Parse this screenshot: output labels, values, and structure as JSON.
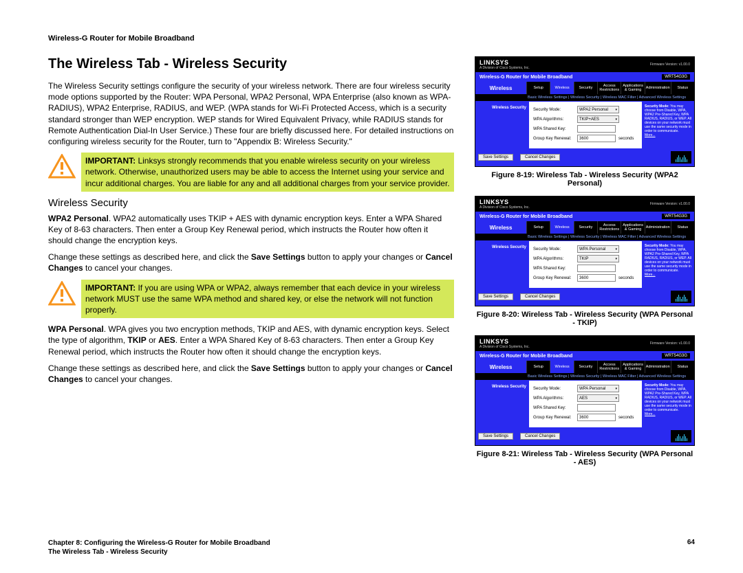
{
  "doc_header": "Wireless-G Router for Mobile Broadband",
  "section_title": "The Wireless Tab - Wireless Security",
  "intro": "The Wireless Security settings configure the security of your wireless network. There are four wireless security mode options supported by the Router: WPA Personal, WPA2 Personal, WPA Enterprise (also known as WPA-RADIUS), WPA2 Enterprise, RADIUS, and WEP. (WPA stands for Wi-Fi Protected Access, which is a security standard stronger than WEP encryption. WEP stands for Wired Equivalent Privacy, while RADIUS stands for Remote Authentication Dial-In User Service.) These four are briefly discussed here. For detailed instructions on configuring wireless security for the Router, turn to \"Appendix B: Wireless Security.\"",
  "callout1_bold": "IMPORTANT:",
  "callout1_text": " Linksys strongly recommends that you enable wireless security on your wireless network. Otherwise, unauthorized users may be able to access the Internet using your service and incur additional charges. You are liable for any and all additional charges from your service provider.",
  "subhead": "Wireless Security",
  "wpa2_head": "WPA2 Personal",
  "wpa2_text": ". WPA2 automatically uses TKIP + AES with dynamic encryption keys. Enter a WPA Shared Key of 8-63 characters. Then enter a Group Key Renewal period, which instructs the Router how often it should change the encryption keys.",
  "change1_a": "Change these settings as described here, and click the ",
  "save_settings": "Save Settings",
  "change1_b": " button to apply your changes or ",
  "cancel_changes": "Cancel Changes",
  "change1_c": " to cancel your changes.",
  "callout2_bold": "IMPORTANT:",
  "callout2_text": "  If you are using WPA or WPA2, always remember that each device in your wireless network MUST use the same WPA method and shared key, or else the network will not function properly.",
  "wpa_head": "WPA Personal",
  "wpa_text_a": ". WPA gives you two encryption methods, TKIP and AES, with dynamic encryption keys. Select the type of algorithm, ",
  "tkip": "TKIP",
  "or": " or ",
  "aes": "AES",
  "wpa_text_b": ". Enter a WPA Shared Key of 8-63 characters. Then enter a Group Key Renewal period, which instructs the Router how often it should change the encryption keys.",
  "footer_ch": "Chapter 8: Configuring the Wireless-G Router for Mobile Broadband",
  "footer_sec": "The Wireless Tab - Wireless Security",
  "page_num": "64",
  "fig19": "Figure 8-19: Wireless Tab - Wireless Security (WPA2 Personal)",
  "fig20": "Figure 8-20: Wireless Tab - Wireless Security (WPA Personal - TKIP)",
  "fig21": "Figure 8-21: Wireless Tab - Wireless Security (WPA Personal - AES)",
  "router": {
    "logo": "LINKSYS",
    "logo_sub": "A Division of Cisco Systems, Inc.",
    "firmware": "Firmware Version: v1.00.0",
    "banner": "Wireless-G Router for Mobile Broadband",
    "model": "WRT54G3G",
    "nav_active": "Wireless",
    "tabs": [
      "Setup",
      "Wireless",
      "Security",
      "Access Restrictions",
      "Applications & Gaming",
      "Administration",
      "Status"
    ],
    "subnav": "Basic Wireless Settings   |   Wireless Security   |   Wireless MAC Filter   |   Advanced Wireless Settings",
    "side_label": "Wireless Security",
    "rows": {
      "mode": "Security Mode:",
      "algo": "WPA Algorithms:",
      "key": "WPA Shared Key:",
      "renew": "Group Key Renewal:"
    },
    "vals19": {
      "mode": "WPA2 Personal",
      "algo": "TKIP+AES",
      "renew": "3600",
      "unit": "seconds"
    },
    "vals20": {
      "mode": "WPA Personal",
      "algo": "TKIP",
      "renew": "3600",
      "unit": "seconds"
    },
    "vals21": {
      "mode": "WPA Personal",
      "algo": "AES",
      "renew": "3600",
      "unit": "seconds"
    },
    "help_head": "Security Mode:",
    "help19": " You may choose from Disable, WPA, WPA2 Pre-Shared Key, WPA RADIUS, RADIUS, or WEP. All devices on your network must use the same security mode in order to communicate.",
    "help_more": "More...",
    "btn_save": "Save Settings",
    "btn_cancel": "Cancel Changes"
  }
}
